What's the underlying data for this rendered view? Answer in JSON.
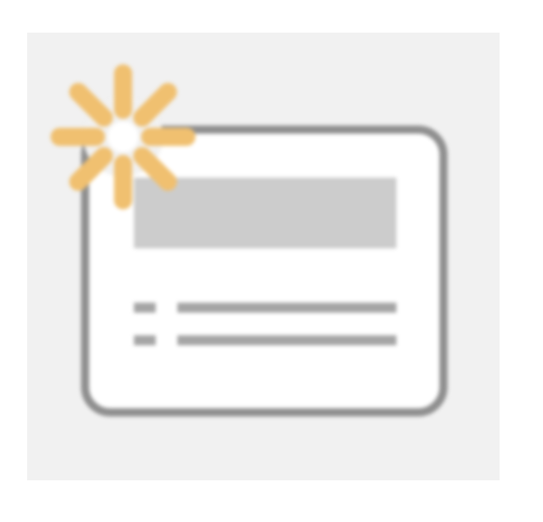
{
  "icon": {
    "name": "new-card-sparkle-icon",
    "colors": {
      "tile_background": "#f1f1f1",
      "card_fill": "#ffffff",
      "card_border": "#8f8f8f",
      "header_bar": "#cccccc",
      "list_lines": "#a5a5a5",
      "sparkle": "#f0c070"
    }
  }
}
